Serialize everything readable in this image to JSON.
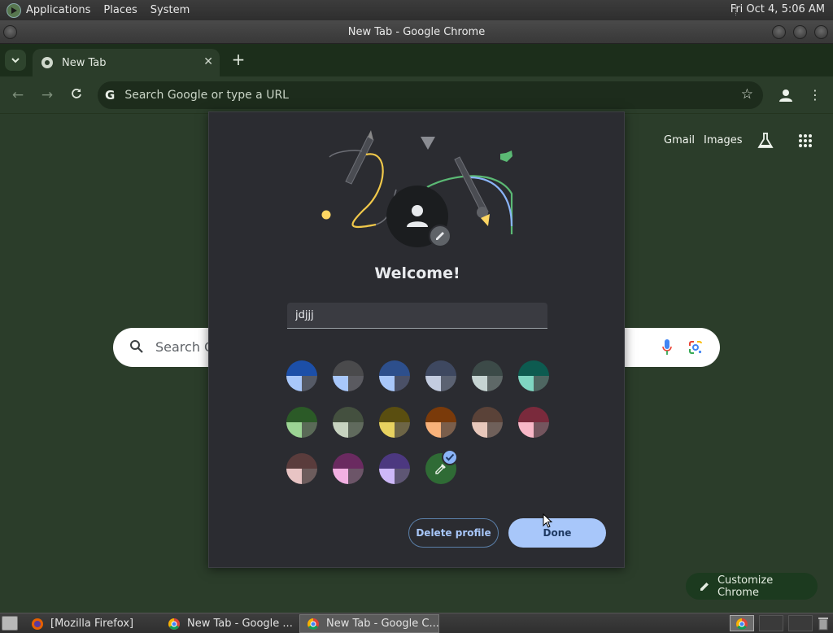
{
  "top_panel": {
    "menus": [
      "Applications",
      "Places",
      "System"
    ],
    "clock": "Fri Oct  4,  5:06 AM"
  },
  "window": {
    "title": "New Tab - Google Chrome"
  },
  "tabs": [
    {
      "label": "New Tab",
      "active": true
    }
  ],
  "toolbar": {
    "omnibox_placeholder": "Search Google or type a URL"
  },
  "ntp": {
    "links": [
      "Gmail",
      "Images"
    ],
    "search_placeholder": "Search G",
    "customize_label": "Customize Chrome"
  },
  "profile_dialog": {
    "title": "Welcome!",
    "name_value": "jdjjj",
    "color_swatches": [
      {
        "top": "#1c4fa8",
        "bl": "#a8c7fa",
        "br": "#555a66"
      },
      {
        "top": "#4a4a4c",
        "bl": "#a8c7fa",
        "br": "#5a5a60"
      },
      {
        "top": "#2d4f8c",
        "bl": "#a8c7fa",
        "br": "#4a5066"
      },
      {
        "top": "#3e4860",
        "bl": "#c3cce0",
        "br": "#5b6272"
      },
      {
        "top": "#3c4a48",
        "bl": "#c6d4d2",
        "br": "#5e6867"
      },
      {
        "top": "#0d5b50",
        "bl": "#7fd6c2",
        "br": "#4e6661"
      },
      {
        "top": "#2b5a27",
        "bl": "#9cd494",
        "br": "#5a6a57"
      },
      {
        "top": "#44503f",
        "bl": "#c7d3c0",
        "br": "#606a5d"
      },
      {
        "top": "#5a4e10",
        "bl": "#e8d260",
        "br": "#6d6546"
      },
      {
        "top": "#7a3a0a",
        "bl": "#f8b27a",
        "br": "#7a5e4b"
      },
      {
        "top": "#5a4238",
        "bl": "#e8c8bb",
        "br": "#6f605a"
      },
      {
        "top": "#7a2a3c",
        "bl": "#f8b8c8",
        "br": "#74555e"
      },
      {
        "top": "#5a3c3c",
        "bl": "#e8c4c4",
        "br": "#6c5c5c"
      },
      {
        "top": "#6a2a60",
        "bl": "#f2b0e2",
        "br": "#6c5568"
      },
      {
        "top": "#4c3880",
        "bl": "#cdb8f8",
        "br": "#5e5674"
      }
    ],
    "delete_label": "Delete profile",
    "done_label": "Done",
    "accent": "#a8c7fa"
  },
  "taskbar": {
    "tasks": [
      {
        "label": "[Mozilla Firefox]",
        "icon": "firefox-icon",
        "active": false
      },
      {
        "label": "New Tab - Google ...",
        "icon": "chrome-icon",
        "active": false
      },
      {
        "label": "New Tab - Google C...",
        "icon": "chrome-icon",
        "active": true
      }
    ]
  }
}
